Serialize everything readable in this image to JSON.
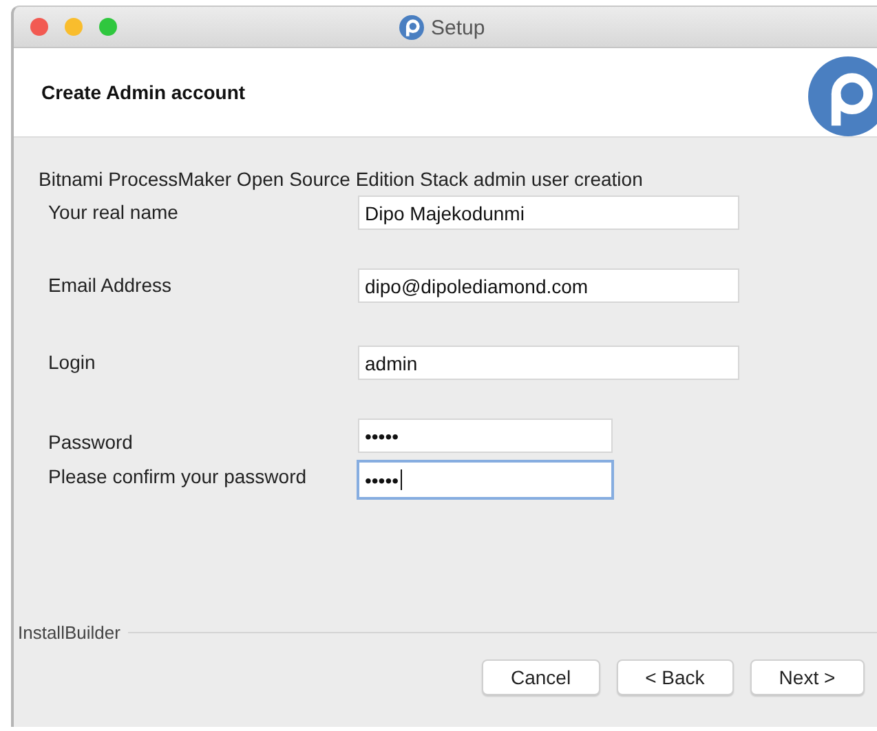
{
  "window": {
    "title": "Setup"
  },
  "header": {
    "title": "Create Admin account"
  },
  "intro": "Bitnami ProcessMaker Open Source Edition Stack admin user creation",
  "fields": [
    {
      "label": "Your real name",
      "kind": "text",
      "value": "Dipo Majekodunmi",
      "focused": false
    },
    {
      "label": "Email Address",
      "kind": "text",
      "value": "dipo@dipolediamond.com",
      "focused": false
    },
    {
      "label": "Login",
      "kind": "text",
      "value": "admin",
      "focused": false
    },
    {
      "label": "Password",
      "kind": "password",
      "value": "•••••",
      "focused": false
    },
    {
      "label": "Please confirm your password",
      "kind": "password",
      "value": "•••••",
      "focused": true
    }
  ],
  "footer": {
    "brand": "InstallBuilder"
  },
  "buttons": [
    "Cancel",
    "< Back",
    "Next >"
  ]
}
